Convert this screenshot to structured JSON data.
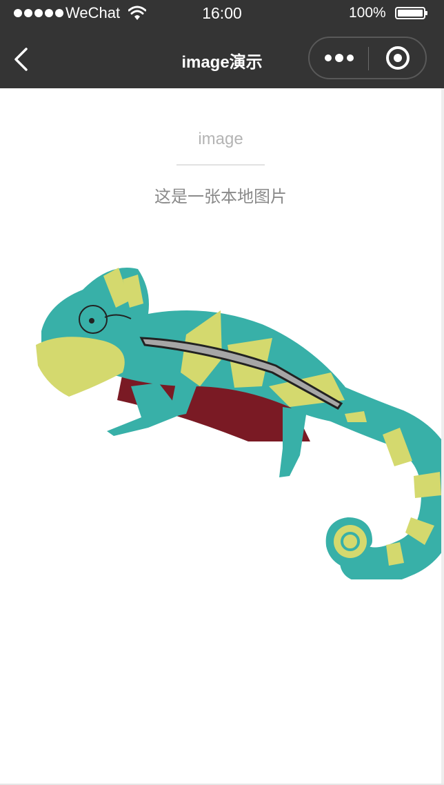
{
  "status_bar": {
    "carrier": "WeChat",
    "time": "16:00",
    "battery": "100%",
    "signal_icon": "signal-dots-icon",
    "wifi_icon": "wifi-icon",
    "battery_icon": "battery-icon",
    "battery_level": 1.0
  },
  "nav": {
    "title": "image演示",
    "back_icon": "chevron-left-icon",
    "more_icon": "more-dots-icon",
    "close_icon": "target-circle-icon"
  },
  "page": {
    "section_title": "image",
    "description": "这是一张本地图片"
  },
  "colors": {
    "nav_bg": "#343434",
    "page_bg": "#ffffff",
    "title_text": "#b4b4b4",
    "desc_text": "#8a8a8a",
    "chameleon_teal": "#38b0a8",
    "chameleon_yellow": "#d4d96e",
    "chameleon_red": "#7a1a24"
  }
}
